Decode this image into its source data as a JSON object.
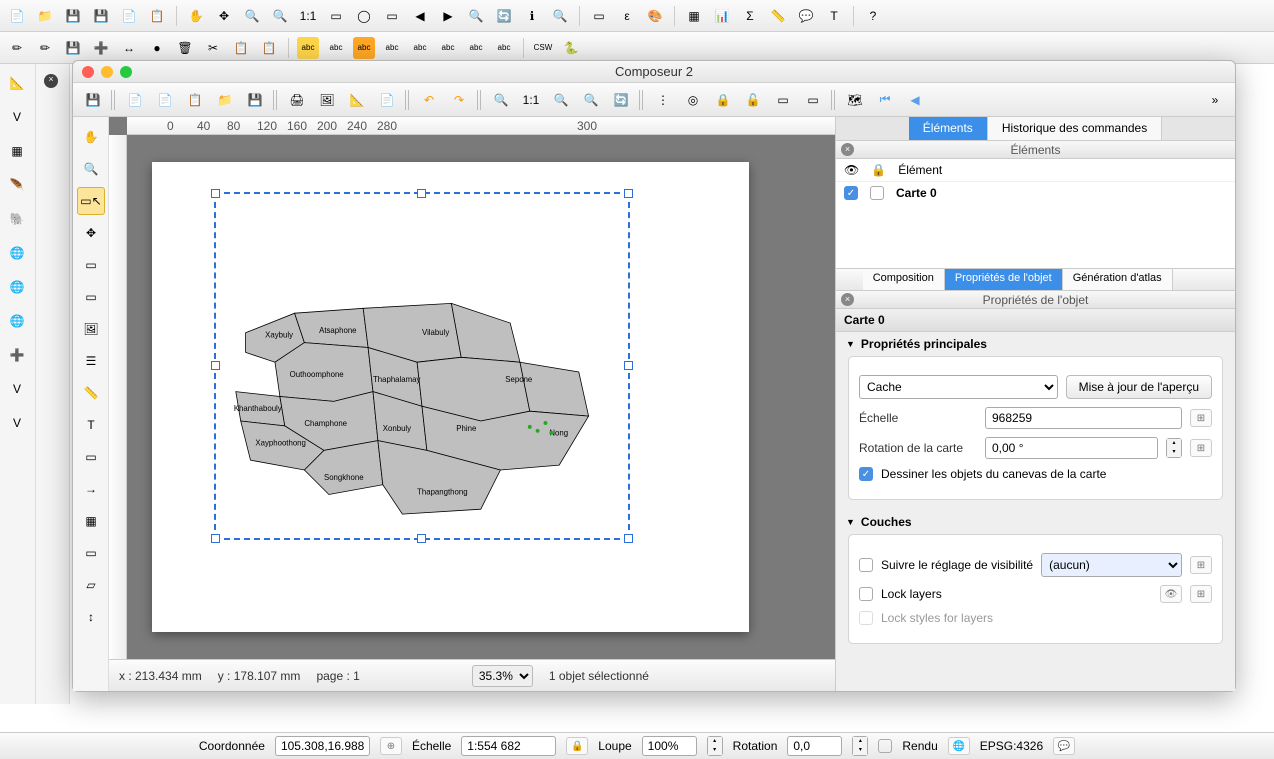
{
  "main_toolbar_icons": [
    "new",
    "open",
    "save",
    "save-as",
    "new-layer",
    "pan",
    "full-extent",
    "zoom-in",
    "zoom-out",
    "1:1",
    "select",
    "select-lasso",
    "identify",
    "zoom-prev",
    "zoom-next",
    "zoom-layer",
    "zoom-sel",
    "refresh",
    "info",
    "pick",
    "yellow-sel",
    "eps",
    "style",
    "table",
    "histogram",
    "sigma",
    "measure",
    "tip",
    "text",
    "help"
  ],
  "composer": {
    "title": "Composeur 2",
    "tabs": {
      "elements": "Éléments",
      "history": "Historique des commandes"
    },
    "panel_title": "Éléments",
    "elem_header": "Élément",
    "elem_name": "Carte 0",
    "sub_tabs": {
      "composition": "Composition",
      "props": "Propriétés de l'objet",
      "atlas": "Génération d'atlas"
    },
    "panel_props_title": "Propriétés de l'objet",
    "obj": "Carte 0",
    "sections": {
      "main": {
        "title": "Propriétés principales",
        "cache": "Cache",
        "update_preview": "Mise à jour de l'aperçu",
        "scale_label": "Échelle",
        "scale_value": "968259",
        "rotation_label": "Rotation de la carte",
        "rotation_value": "0,00 °",
        "draw_items": "Dessiner les objets du canevas de la carte"
      },
      "layers": {
        "title": "Couches",
        "follow": "Suivre le réglage de visibilité",
        "none": "(aucun)",
        "lock_layers": "Lock layers",
        "lock_styles": "Lock styles for layers"
      }
    },
    "status": {
      "x": "x : 213.434 mm",
      "y": "y : 178.107 mm",
      "page": "page : 1",
      "zoom": "35.3%",
      "selection": "1 objet sélectionné"
    }
  },
  "map_labels": [
    "Xaybuly",
    "Atsaphone",
    "Vilabuly",
    "Outhoomphone",
    "Thaphalamay",
    "Sepone",
    "Khanthabouly",
    "Champhone",
    "Xonbuly",
    "Phine",
    "Nong",
    "Xayphoothong",
    "Songkhone",
    "Thapangthong"
  ],
  "bottom": {
    "coord_label": "Coordonnée",
    "coord_value": "105.308,16.988",
    "scale_label": "Échelle",
    "scale_value": "1:554 682",
    "mag_label": "Loupe",
    "mag_value": "100%",
    "rot_label": "Rotation",
    "rot_value": "0,0",
    "render": "Rendu",
    "crs": "EPSG:4326"
  }
}
